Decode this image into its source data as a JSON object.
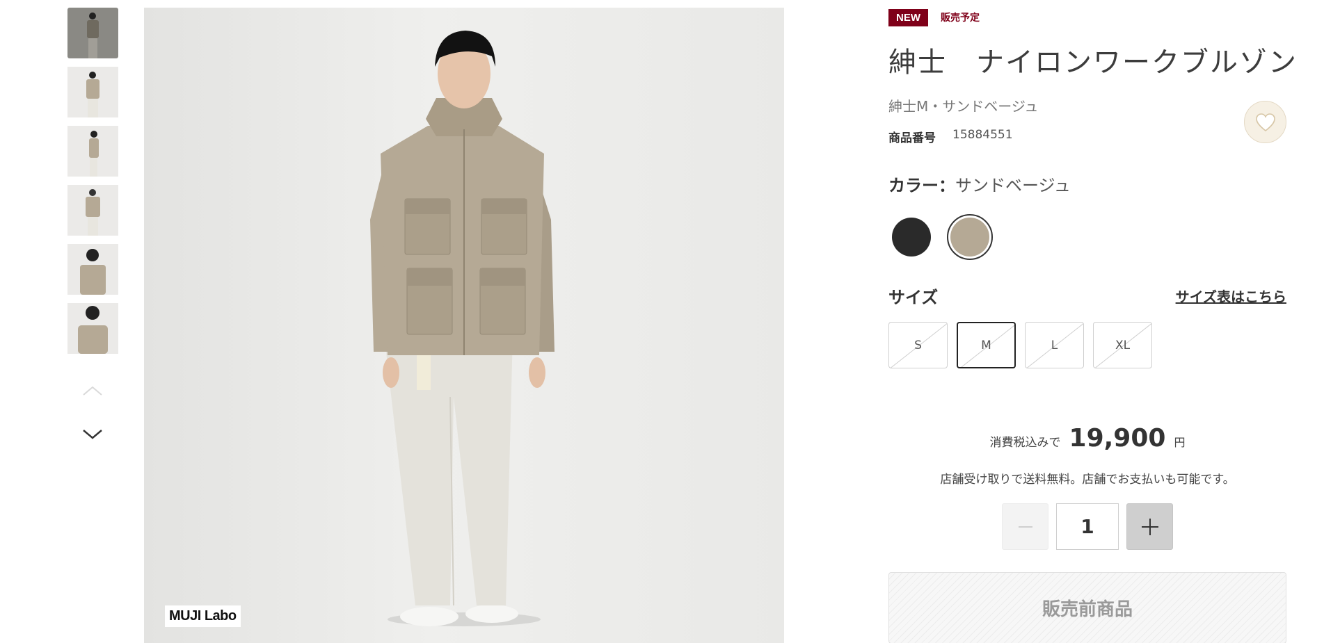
{
  "product": {
    "badge_new": "NEW",
    "badge_status": "販売予定",
    "title": "紳士　ナイロンワークブルゾン",
    "subtitle": "紳士M・サンドベージュ",
    "code_label": "商品番号",
    "code_value": "15884551",
    "brand_logo": "MUJI Labo"
  },
  "color": {
    "label": "カラー：",
    "selected": "サンドベージュ",
    "swatches": [
      {
        "name": "ブラック",
        "hex": "#2a2a2a"
      },
      {
        "name": "サンドベージュ",
        "hex": "#b5a995"
      }
    ]
  },
  "size": {
    "label": "サイズ",
    "chart_link": "サイズ表はこちら",
    "options": [
      "S",
      "M",
      "L",
      "XL"
    ],
    "selected": "M"
  },
  "price": {
    "label": "消費税込みで",
    "value": "19,900",
    "unit": "円"
  },
  "note": "店舗受け取りで送料無料。店舗でお支払いも可能です。",
  "quantity": {
    "value": "1"
  },
  "cta": {
    "label": "販売前商品"
  },
  "colors": {
    "brand": "#7f0019",
    "jacket": "#b5a995",
    "background": "#ebebe9"
  },
  "thumbnails": {
    "count": 6,
    "active_index": 0
  }
}
